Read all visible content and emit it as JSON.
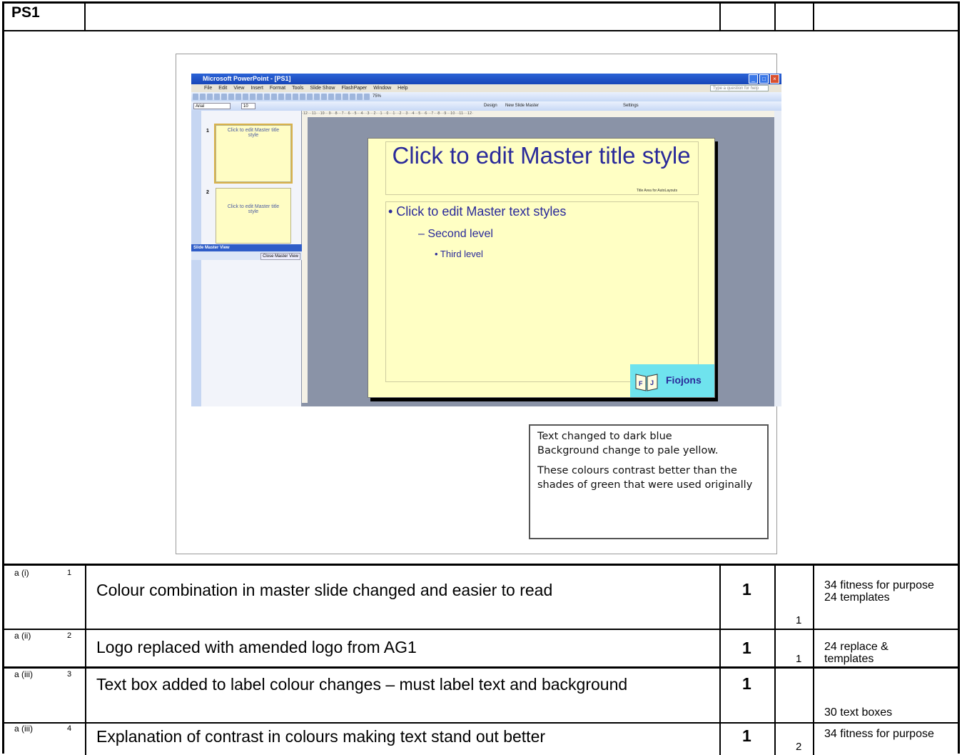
{
  "header": {
    "code": "PS1"
  },
  "screenshot": {
    "window_title": "Microsoft PowerPoint - [PS1]",
    "menu": [
      "File",
      "Edit",
      "View",
      "Insert",
      "Format",
      "Tools",
      "Slide Show",
      "FlashPaper",
      "Window",
      "Help"
    ],
    "help_placeholder": "Type a question for help",
    "zoom": "75%",
    "font_name": "Arial",
    "font_size": "10",
    "toolbar_design": "Design",
    "toolbar_new_master": "New Slide Master",
    "toolbar_settings": "Settings",
    "ruler_text": "·12···11···10···9···8···7···6···5···4···3···2···1···0···1···2···3···4···5···6···7···8···9···10···11···12·",
    "thumb1_num": "1",
    "thumb1_title": "Click to edit Master title style",
    "thumb2_num": "2",
    "thumb2_title": "Click to edit Master title style",
    "slide_master_view": "Slide Master View",
    "close_master_view": "Close Master View",
    "slide_title": "Click to edit Master title style",
    "title_area_note": "Title Area for AutoLayouts",
    "level1": "• Click to edit Master text styles",
    "level2": "– Second level",
    "level3": "• Third level",
    "logo_text": "Fiojons",
    "logo_letters": [
      "F",
      "J"
    ]
  },
  "callout": {
    "line1": "Text changed to dark blue",
    "line2": "Background change to pale yellow.",
    "para2": "These colours contrast better than the shades of green that were used originally"
  },
  "rows": [
    {
      "label": "a (i)",
      "num": "1",
      "text": "Colour combination in master slide changed and easier to read",
      "mark": "1",
      "sub": "1",
      "ref": "34 fitness for purpose\n24 templates"
    },
    {
      "label": "a (ii)",
      "num": "2",
      "text": "Logo replaced with amended logo from AG1",
      "mark": "1",
      "sub": "1",
      "ref": "24 replace & templates"
    },
    {
      "label": "a (iii)",
      "num": "3",
      "text": "Text box added to label colour changes – must label text and background",
      "mark": "1",
      "sub": "",
      "ref": "30 text boxes"
    },
    {
      "label": "a (iii)",
      "num": "4",
      "text": "Explanation of contrast in colours making text stand out better",
      "mark": "1",
      "sub": "2",
      "ref": "34 fitness for purpose"
    }
  ],
  "colors": {
    "slide_bg": "#ffffc4",
    "slide_text": "#2a2a9a",
    "logo_bg": "#6fe3ee"
  }
}
